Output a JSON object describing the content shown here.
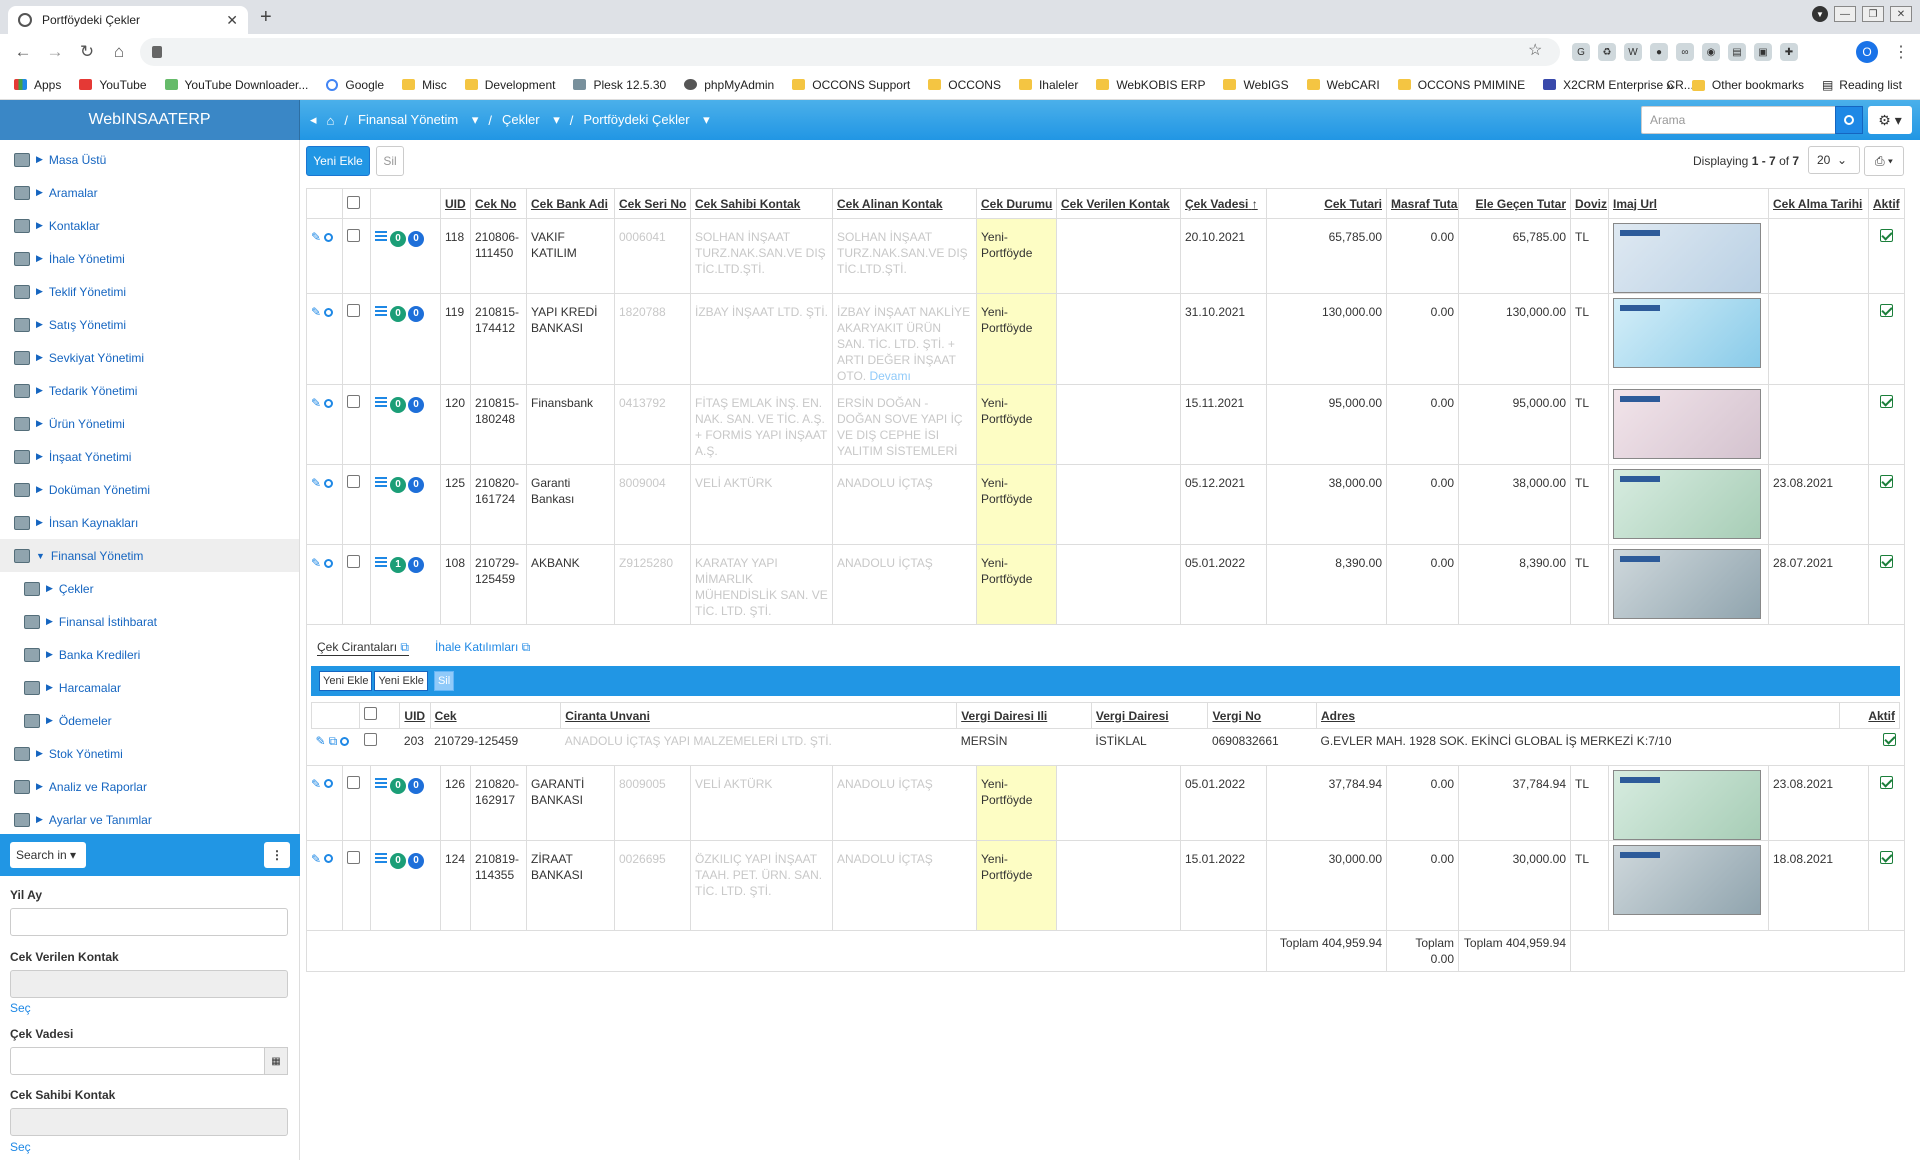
{
  "browser": {
    "tab_title": "Portföydeki Çekler",
    "bookmarks": [
      "Apps",
      "YouTube",
      "YouTube Downloader...",
      "Google",
      "Misc",
      "Development",
      "Plesk 12.5.30",
      "phpMyAdmin",
      "OCCONS Support",
      "OCCONS",
      "Ihaleler",
      "WebKOBIS ERP",
      "WebIGS",
      "WebCARI",
      "OCCONS PMIMINE",
      "X2CRM Enterprise CR..."
    ],
    "bookmarks_more": "»",
    "other_bookmarks": "Other bookmarks",
    "reading_list": "Reading list",
    "profile_initial": "O"
  },
  "app": {
    "brand": "WebINSAATERP",
    "breadcrumb": [
      "Finansal Yönetim",
      "Çekler",
      "Portföydeki Çekler"
    ],
    "search_placeholder": "Arama"
  },
  "sidebar": {
    "items": [
      {
        "label": "Masa Üstü"
      },
      {
        "label": "Aramalar"
      },
      {
        "label": "Kontaklar"
      },
      {
        "label": "İhale Yönetimi"
      },
      {
        "label": "Teklif Yönetimi"
      },
      {
        "label": "Satış Yönetimi"
      },
      {
        "label": "Sevkiyat Yönetimi"
      },
      {
        "label": "Tedarik Yönetimi"
      },
      {
        "label": "Ürün Yönetimi"
      },
      {
        "label": "İnşaat Yönetimi"
      },
      {
        "label": "Doküman Yönetimi"
      },
      {
        "label": "İnsan Kaynakları"
      },
      {
        "label": "Finansal Yönetim"
      }
    ],
    "sub_items": [
      {
        "label": "Çekler"
      },
      {
        "label": "Finansal İstihbarat"
      },
      {
        "label": "Banka Kredileri"
      },
      {
        "label": "Harcamalar"
      },
      {
        "label": "Ödemeler"
      }
    ],
    "bottom_items": [
      {
        "label": "Stok Yönetimi"
      },
      {
        "label": "Analiz ve Raporlar"
      },
      {
        "label": "Ayarlar ve Tanımlar"
      }
    ],
    "search_in": "Search in",
    "filters": {
      "yil_ay": "Yil Ay",
      "cek_verilen": "Cek Verilen Kontak",
      "cek_vadesi": "Çek Vadesi",
      "cek_sahibi": "Cek Sahibi Kontak",
      "sec": "Seç"
    }
  },
  "toolbar": {
    "new_label": "Yeni Ekle",
    "delete_label": "Sil",
    "displaying_prefix": "Displaying",
    "displaying_range": "1 - 7",
    "displaying_of": "of",
    "displaying_total": "7",
    "page_size": "20"
  },
  "grid": {
    "columns": [
      "UID",
      "Cek No",
      "Cek Bank Adi",
      "Cek Seri No",
      "Cek Sahibi Kontak",
      "Cek Alinan Kontak",
      "Cek Durumu",
      "Cek Verilen Kontak",
      "Çek Vadesi",
      "Cek Tutari",
      "Masraf Tutarı",
      "Ele Geçen Tutar",
      "Doviz",
      "Imaj Url",
      "Cek Alma Tarihi",
      "Aktif"
    ],
    "rows": [
      {
        "b1": "0",
        "b2": "0",
        "uid": "118",
        "cek_no": "210806-111450",
        "bank": "VAKIF KATILIM",
        "seri": "0006041",
        "sahibi": "SOLHAN İNŞAAT TURZ.NAK.SAN.VE DIŞ TİC.LTD.ŞTİ.",
        "alinan": "SOLHAN İNŞAAT TURZ.NAK.SAN.VE DIŞ TİC.LTD.ŞTİ.",
        "durum": "Yeni-Portföyde",
        "verilen": "",
        "vade": "20.10.2021",
        "tutar": "65,785.00",
        "masraf": "0.00",
        "ele": "65,785.00",
        "doviz": "TL",
        "img": "",
        "alma": ""
      },
      {
        "b1": "0",
        "b2": "0",
        "uid": "119",
        "cek_no": "210815-174412",
        "bank": "YAPI KREDİ BANKASI",
        "seri": "1820788",
        "sahibi": "İZBAY İNŞAAT LTD. ŞTİ.",
        "alinan": "İZBAY İNŞAAT NAKLİYE AKARYAKIT ÜRÜN SAN. TİC. LTD. ŞTİ. + ARTI DEĞER İNŞAAT OTO.",
        "durum": "Yeni-Portföyde",
        "verilen": "",
        "vade": "31.10.2021",
        "tutar": "130,000.00",
        "masraf": "0.00",
        "ele": "130,000.00",
        "doviz": "TL",
        "img": "cyan",
        "alma": "",
        "more": "Devamı"
      },
      {
        "b1": "0",
        "b2": "0",
        "uid": "120",
        "cek_no": "210815-180248",
        "bank": "Finansbank",
        "seri": "0413792",
        "sahibi": "FİTAŞ EMLAK İNŞ. EN. NAK. SAN. VE TİC. A.Ş. + FORMİS YAPI İNŞAAT A.Ş.",
        "alinan": "ERSİN DOĞAN - DOĞAN SOVE YAPI İÇ VE DIŞ CEPHE İSI YALITIM SİSTEMLERİ",
        "durum": "Yeni-Portföyde",
        "verilen": "",
        "vade": "15.11.2021",
        "tutar": "95,000.00",
        "masraf": "0.00",
        "ele": "95,000.00",
        "doviz": "TL",
        "img": "pink",
        "alma": ""
      },
      {
        "b1": "0",
        "b2": "0",
        "uid": "125",
        "cek_no": "210820-161724",
        "bank": "Garanti Bankası",
        "seri": "8009004",
        "sahibi": "VELİ AKTÜRK",
        "alinan": "ANADOLU İÇTAŞ",
        "durum": "Yeni-Portföyde",
        "verilen": "",
        "vade": "05.12.2021",
        "tutar": "38,000.00",
        "masraf": "0.00",
        "ele": "38,000.00",
        "doviz": "TL",
        "img": "garanti",
        "alma": "23.08.2021"
      },
      {
        "b1": "1",
        "b2": "0",
        "uid": "108",
        "cek_no": "210729-125459",
        "bank": "AKBANK",
        "seri": "Z9125280",
        "sahibi": "KARATAY YAPI MİMARLIK MÜHENDİSLİK SAN. VE TİC. LTD. ŞTİ.",
        "alinan": "ANADOLU İÇTAŞ",
        "durum": "Yeni-Portföyde",
        "verilen": "",
        "vade": "05.01.2022",
        "tutar": "8,390.00",
        "masraf": "0.00",
        "ele": "8,390.00",
        "doviz": "TL",
        "img": "dark",
        "alma": "28.07.2021"
      }
    ],
    "rows2": [
      {
        "b1": "0",
        "b2": "0",
        "uid": "126",
        "cek_no": "210820-162917",
        "bank": "GARANTİ BANKASI",
        "seri": "8009005",
        "sahibi": "VELİ AKTÜRK",
        "alinan": "ANADOLU İÇTAŞ",
        "durum": "Yeni-Portföyde",
        "verilen": "",
        "vade": "05.01.2022",
        "tutar": "37,784.94",
        "masraf": "0.00",
        "ele": "37,784.94",
        "doviz": "TL",
        "img": "garanti",
        "alma": "23.08.2021"
      },
      {
        "b1": "0",
        "b2": "0",
        "uid": "124",
        "cek_no": "210819-114355",
        "bank": "ZİRAAT BANKASI",
        "seri": "0026695",
        "sahibi": "ÖZKILIÇ YAPI İNŞAAT TAAH. PET. ÜRN. SAN. TİC. LTD. ŞTİ.",
        "alinan": "ANADOLU İÇTAŞ",
        "durum": "Yeni-Portföyde",
        "verilen": "",
        "vade": "15.01.2022",
        "tutar": "30,000.00",
        "masraf": "0.00",
        "ele": "30,000.00",
        "doviz": "TL",
        "img": "dark",
        "alma": "18.08.2021"
      }
    ],
    "totals": {
      "tutar": "Toplam 404,959.94",
      "masraf": "Toplam 0.00",
      "ele": "Toplam 404,959.94"
    }
  },
  "detail": {
    "tabs": [
      "Çek Cirantaları",
      "İhale Katılımları"
    ],
    "buttons": [
      "Yeni Ekle",
      "Yeni Ekle",
      "Sil"
    ],
    "columns": [
      "UID",
      "Cek",
      "Ciranta Unvani",
      "Vergi Dairesi Ili",
      "Vergi Dairesi",
      "Vergi No",
      "Adres",
      "Aktif"
    ],
    "row": {
      "uid": "203",
      "cek": "210729-125459",
      "unvan": "ANADOLU İÇTAŞ YAPI MALZEMELERİ LTD. ŞTİ.",
      "il": "MERSİN",
      "daire": "İSTİKLAL",
      "no": "0690832661",
      "adres": "G.EVLER MAH. 1928 SOK. EKİNCİ GLOBAL İŞ MERKEZİ K:7/10"
    }
  }
}
